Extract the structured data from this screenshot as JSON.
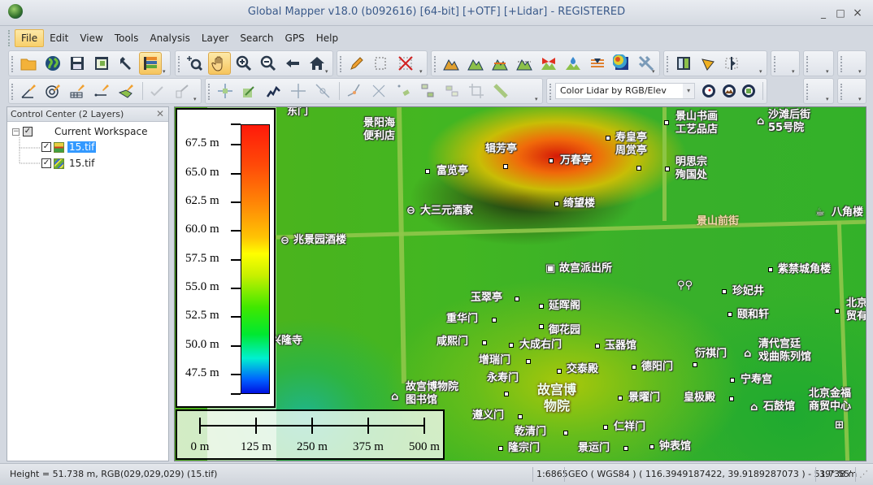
{
  "window": {
    "title": "Global Mapper v18.0 (b092616) [64-bit] [+OTF] [+Lidar] - REGISTERED",
    "minimize": "_",
    "maximize": "□",
    "close": "×"
  },
  "menu": [
    "File",
    "Edit",
    "View",
    "Tools",
    "Analysis",
    "Layer",
    "Search",
    "GPS",
    "Help"
  ],
  "toolbar": {
    "file_tools": [
      "open-folder",
      "load-online-data",
      "save-workspace",
      "config-window",
      "settings-wrench",
      "overlay-control-center"
    ],
    "view_tools": [
      "zoom-box",
      "pan-hand",
      "zoom-in",
      "zoom-out",
      "back-arrow",
      "full-view-home"
    ],
    "edit_tools": [
      "digitizer-pencil",
      "feature-select",
      "delete-features"
    ],
    "analysis_tools": [
      "elevation-profile",
      "3d-view",
      "watershed",
      "volume",
      "line-of-sight",
      "water-drop",
      "view-shed",
      "contour-gen",
      "drone-tool"
    ],
    "misc_tools": [
      "split-view",
      "path-profile",
      "measure-tool"
    ],
    "lidar_edit_tools": [
      "create-area",
      "radius-tool",
      "grid-tool",
      "create-line",
      "create-area-fill",
      "check-tool",
      "point-tool"
    ],
    "vertex_tools": [
      "move-vertex",
      "rotate-scale",
      "reshape",
      "move-point",
      "insert-vertex",
      "connect-line",
      "split-line",
      "snap-vertex",
      "combine",
      "duplicate",
      "crop",
      "measure"
    ],
    "lidar_display_mode": "Color Lidar by RGB/Elev",
    "lidar_tools": [
      "lidar-classify",
      "lidar-terrain",
      "lidar-building"
    ]
  },
  "control_center": {
    "title": "Control Center (2 Layers)",
    "workspace": "Current Workspace",
    "layers": [
      {
        "name": "15.tif",
        "checked": true,
        "selected": true
      },
      {
        "name": "15.tif",
        "checked": true,
        "selected": false
      }
    ]
  },
  "legend": {
    "ticks": [
      "67.5 m",
      "65.0 m",
      "62.5 m",
      "60.0 m",
      "57.5 m",
      "55.0 m",
      "52.5 m",
      "50.0 m",
      "47.5 m"
    ],
    "range_m": [
      45.8,
      69.3
    ]
  },
  "scalebar": {
    "labels": [
      "0 m",
      "125 m",
      "250 m",
      "375 m",
      "500 m"
    ]
  },
  "map_labels": {
    "l1": "东门",
    "l2": "景阳海\n便利店",
    "l3": "辑芳亭",
    "l4": "万春亭",
    "l5": "寿皇亭\n周赏亭",
    "l6": "景山书画\n工艺品店",
    "l7": "沙滩后街\n55号院",
    "l8": "富览亭",
    "l9": "明思宗\n殉国处",
    "l10": "大三元酒家",
    "l11": "绮望楼",
    "l12": "景山前街",
    "l13": "八角楼",
    "l14": "兆景园酒楼",
    "l15": "故宫派出所",
    "l16": "紫禁城角楼",
    "l17": "玉翠亭",
    "l18": "延晖阁",
    "l19": "珍妃井",
    "l20": "重华门",
    "l21": "御花园",
    "l22": "颐和轩",
    "l23": "咸熙门",
    "l24": "大成右门",
    "l25": "玉器馆",
    "l26": "衍祺门",
    "l27": "清代宫廷\n戏曲陈列馆",
    "l28": "增瑞门",
    "l29": "交泰殿",
    "l30": "德阳门",
    "l31": "永寿门",
    "l32": "宁寿宫",
    "l33": "故宫博物院\n图书馆",
    "l34": "故宫博\n物院",
    "l35": "景曜门",
    "l36": "皇极殿",
    "l37": "石鼓馆",
    "l38": "北京金福\n商贸中心",
    "l39": "遵义门",
    "l40": "仁祥门",
    "l41": "乾清门",
    "l42": "隆宗门",
    "l43": "景运门",
    "l44": "钟表馆",
    "l45": "兴隆寺",
    "l46": "北京\n贸有"
  },
  "status": {
    "readout": "Height = 51.738 m, RGB(029,029,029) (15.tif)",
    "scale": "1:6865",
    "coords": "GEO ( WGS84 ) ( 116.3949187422, 39.9189287073 ) - 51.738 m",
    "lat": "39° 55'"
  }
}
